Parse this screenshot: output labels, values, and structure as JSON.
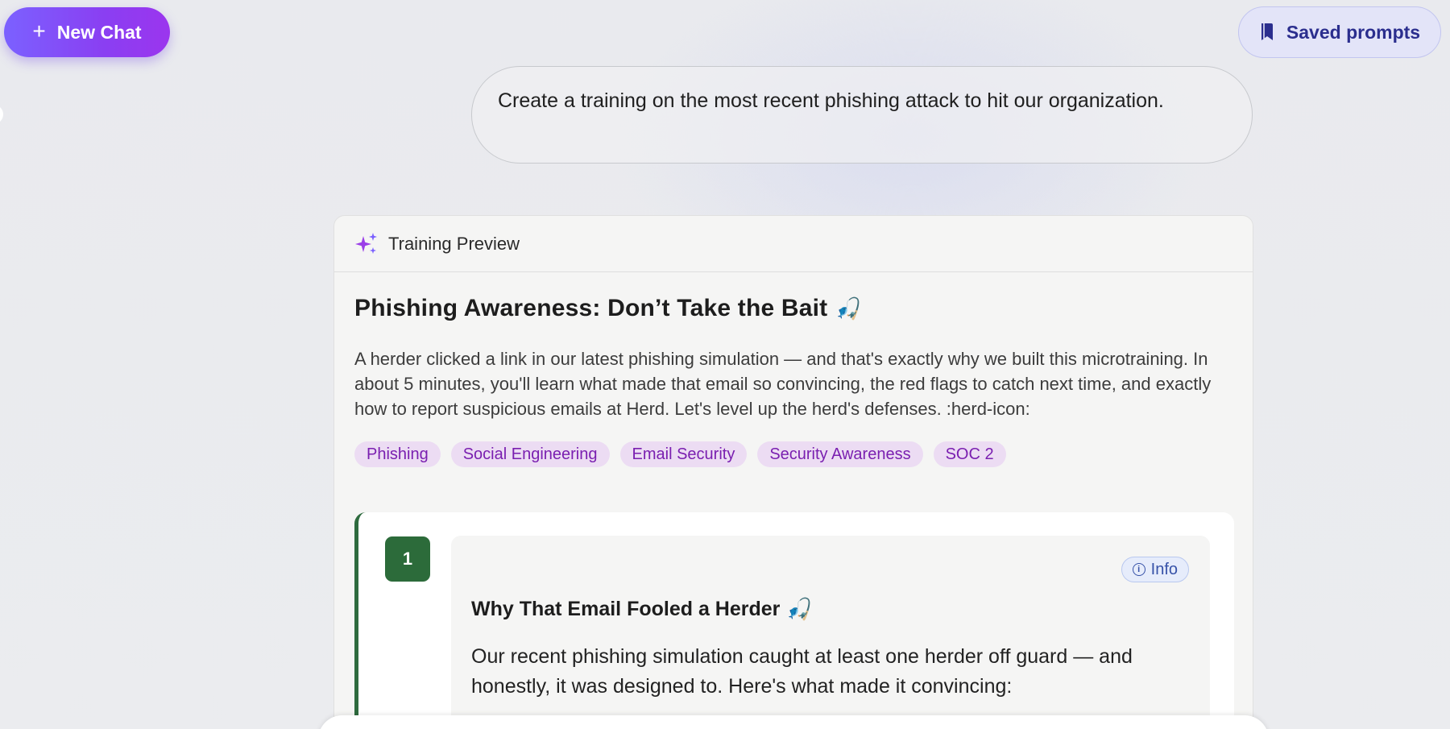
{
  "topbar": {
    "new_chat_label": "New Chat",
    "saved_prompts_label": "Saved prompts"
  },
  "user_message": {
    "text": "Create a training on the most recent phishing attack to hit our organization."
  },
  "preview": {
    "header_label": "Training Preview",
    "title": "Phishing Awareness: Don’t Take the Bait",
    "title_emoji": "🎣",
    "description": "A herder clicked a link in our latest phishing simulation — and that's exactly why we built this microtraining. In about 5 minutes, you'll learn what made that email so convincing, the red flags to catch next time, and exactly how to report suspicious emails at Herd. Let's level up the herd's defenses. :herd-icon:",
    "tags": [
      "Phishing",
      "Social Engineering",
      "Email Security",
      "Security Awareness",
      "SOC 2"
    ],
    "step": {
      "number": "1",
      "badge_label": "Info",
      "title": "Why That Email Fooled a Herder",
      "title_emoji": "🎣",
      "text": "Our recent phishing simulation caught at least one herder off guard — and honestly, it was designed to. Here's what made it convincing:"
    }
  },
  "colors": {
    "new_chat_gradient_start": "#7b61ff",
    "new_chat_gradient_end": "#9b35ee",
    "saved_prompts_bg": "#e3e4f8",
    "tag_bg": "#ecdcf3",
    "tag_text": "#7a1fb0",
    "step_accent": "#2c6b3a",
    "info_badge_text": "#3752a8"
  },
  "icons": {
    "new_chat": "plus-icon",
    "saved_prompts": "bookmark-icon",
    "preview_header": "sparkle-icon",
    "info": "info-icon"
  }
}
